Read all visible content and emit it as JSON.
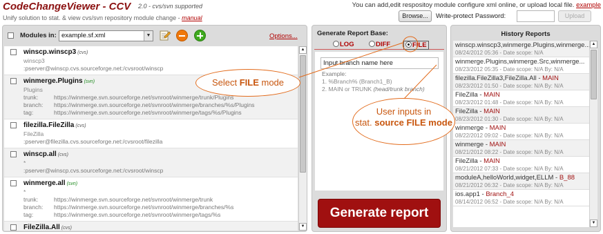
{
  "header": {
    "title": "CodeChangeViewer - CCV",
    "subtitle": "2.0 - cvs/svn supported",
    "unify_text": "Unify solution to stat. & view cvs/svn repository module change - ",
    "manual_link": "manual",
    "info_text": "You can add,edit respositoy module configure xml online, or upload local file. ",
    "example_link": "example",
    "browse_label": "Browse...",
    "write_protect_label": "Write-protect Password:",
    "password_value": "",
    "upload_label": "Upload"
  },
  "modules": {
    "label": "Modules in:",
    "selected_file": "example.sf.xml",
    "options_link": "Options...",
    "items": [
      {
        "name": "winscp.winscp3",
        "type": "(cvs)",
        "lines": [
          {
            "k": "",
            "v": "winscp3"
          },
          {
            "k": "",
            "v": ":pserver@winscp.cvs.sourceforge.net:/cvsroot/winscp"
          }
        ]
      },
      {
        "name": "winmerge.Plugins",
        "type": "(svn)",
        "lines": [
          {
            "k": "",
            "v": "Plugins"
          },
          {
            "k": "trunk:",
            "v": "https://winmerge.svn.sourceforge.net/svnroot/winmerge/trunk/Plugins"
          },
          {
            "k": "branch:",
            "v": "https://winmerge.svn.sourceforge.net/svnroot/winmerge/branches/%s/Plugins"
          },
          {
            "k": "tag:",
            "v": "https://winmerge.svn.sourceforge.net/svnroot/winmerge/tags/%s/Plugins"
          }
        ]
      },
      {
        "name": "filezilla.FileZilla",
        "type": "(cvs)",
        "lines": [
          {
            "k": "",
            "v": "FileZilla"
          },
          {
            "k": "",
            "v": ":pserver@filezilla.cvs.sourceforge.net:/cvsroot/filezilla"
          }
        ]
      },
      {
        "name": "winscp.all",
        "type": "(cvs)",
        "lines": [
          {
            "k": "",
            "v": "*"
          },
          {
            "k": "",
            "v": ":pserver@winscp.cvs.sourceforge.net:/cvsroot/winscp"
          }
        ]
      },
      {
        "name": "winmerge.all",
        "type": "(svn)",
        "lines": [
          {
            "k": "",
            "v": "*"
          },
          {
            "k": "trunk:",
            "v": "https://winmerge.svn.sourceforge.net/svnroot/winmerge/trunk"
          },
          {
            "k": "branch:",
            "v": "https://winmerge.svn.sourceforge.net/svnroot/winmerge/branches/%s"
          },
          {
            "k": "tag:",
            "v": "https://winmerge.svn.sourceforge.net/svnroot/winmerge/tags/%s"
          }
        ]
      },
      {
        "name": "FileZilla.All",
        "type": "(cvs)",
        "lines": []
      }
    ]
  },
  "report": {
    "title": "Generate Report Base:",
    "radio_log": "LOG",
    "radio_diff": "DIFF",
    "radio_file": "FILE",
    "selected": "FILE",
    "branch_input_value": "Input branch name here",
    "example_title": "Example:",
    "example_1": "1. %Branch% (Branch1_B)",
    "example_2_prefix": "2. MAIN or TRUNK ",
    "example_2_hint": "(head/trunk branch)",
    "generate_label": "Generate report"
  },
  "history": {
    "title": "History Reports",
    "items": [
      {
        "name": "winscp.winscp3,winmerge.Plugins,winmerge...",
        "branch": "",
        "meta": "08/24/2012 05:36 - Date scope: N/A"
      },
      {
        "name": "winmerge.Plugins,winmerge.Src,winmerge...",
        "branch": "",
        "meta": "08/23/2012 05:35 - Date scope: N/A  By: N/A"
      },
      {
        "name": "filezilla.FileZilla3,FileZilla.All - ",
        "branch": "MAIN",
        "meta": "08/23/2012 01:50 - Date scope: N/A  By: N/A"
      },
      {
        "name": "FileZilla - ",
        "branch": "MAIN",
        "meta": "08/23/2012 01:48 - Date scope: N/A  By: N/A"
      },
      {
        "name": "FileZilla - ",
        "branch": "MAIN",
        "meta": "08/23/2012 01:30 - Date scope: N/A  By: N/A"
      },
      {
        "name": "winmerge - ",
        "branch": "MAIN",
        "meta": "08/22/2012 09:02 - Date scope: N/A  By: N/A"
      },
      {
        "name": "winmerge - ",
        "branch": "MAIN",
        "meta": "08/21/2012 08:22 - Date scope: N/A  By: N/A"
      },
      {
        "name": "FileZilla - ",
        "branch": "MAIN",
        "meta": "08/21/2012 07:33 - Date scope: N/A  By: N/A"
      },
      {
        "name": "moduleA,helloWorld,widget,ELLM - ",
        "branch": "B_88",
        "meta": "08/21/2012 06:32 - Date scope: N/A  By: N/A"
      },
      {
        "name": "ios.app1 - ",
        "branch": "Branch_4",
        "meta": "08/14/2012 06:52 - Date scope: N/A  By: N/A"
      }
    ]
  },
  "callouts": {
    "select_pre": "Select ",
    "select_bold": "FILE",
    "select_post": "  mode",
    "user_line1": "User inputs in",
    "user_line2_pre": "stat. ",
    "user_line2_bold": "source FILE mode"
  },
  "colors": {
    "brand": "#8b1111",
    "link": "#b00000",
    "generate_button": "#a01010",
    "callout": "#e26a1a",
    "svn_tag": "#1d8a1d"
  }
}
